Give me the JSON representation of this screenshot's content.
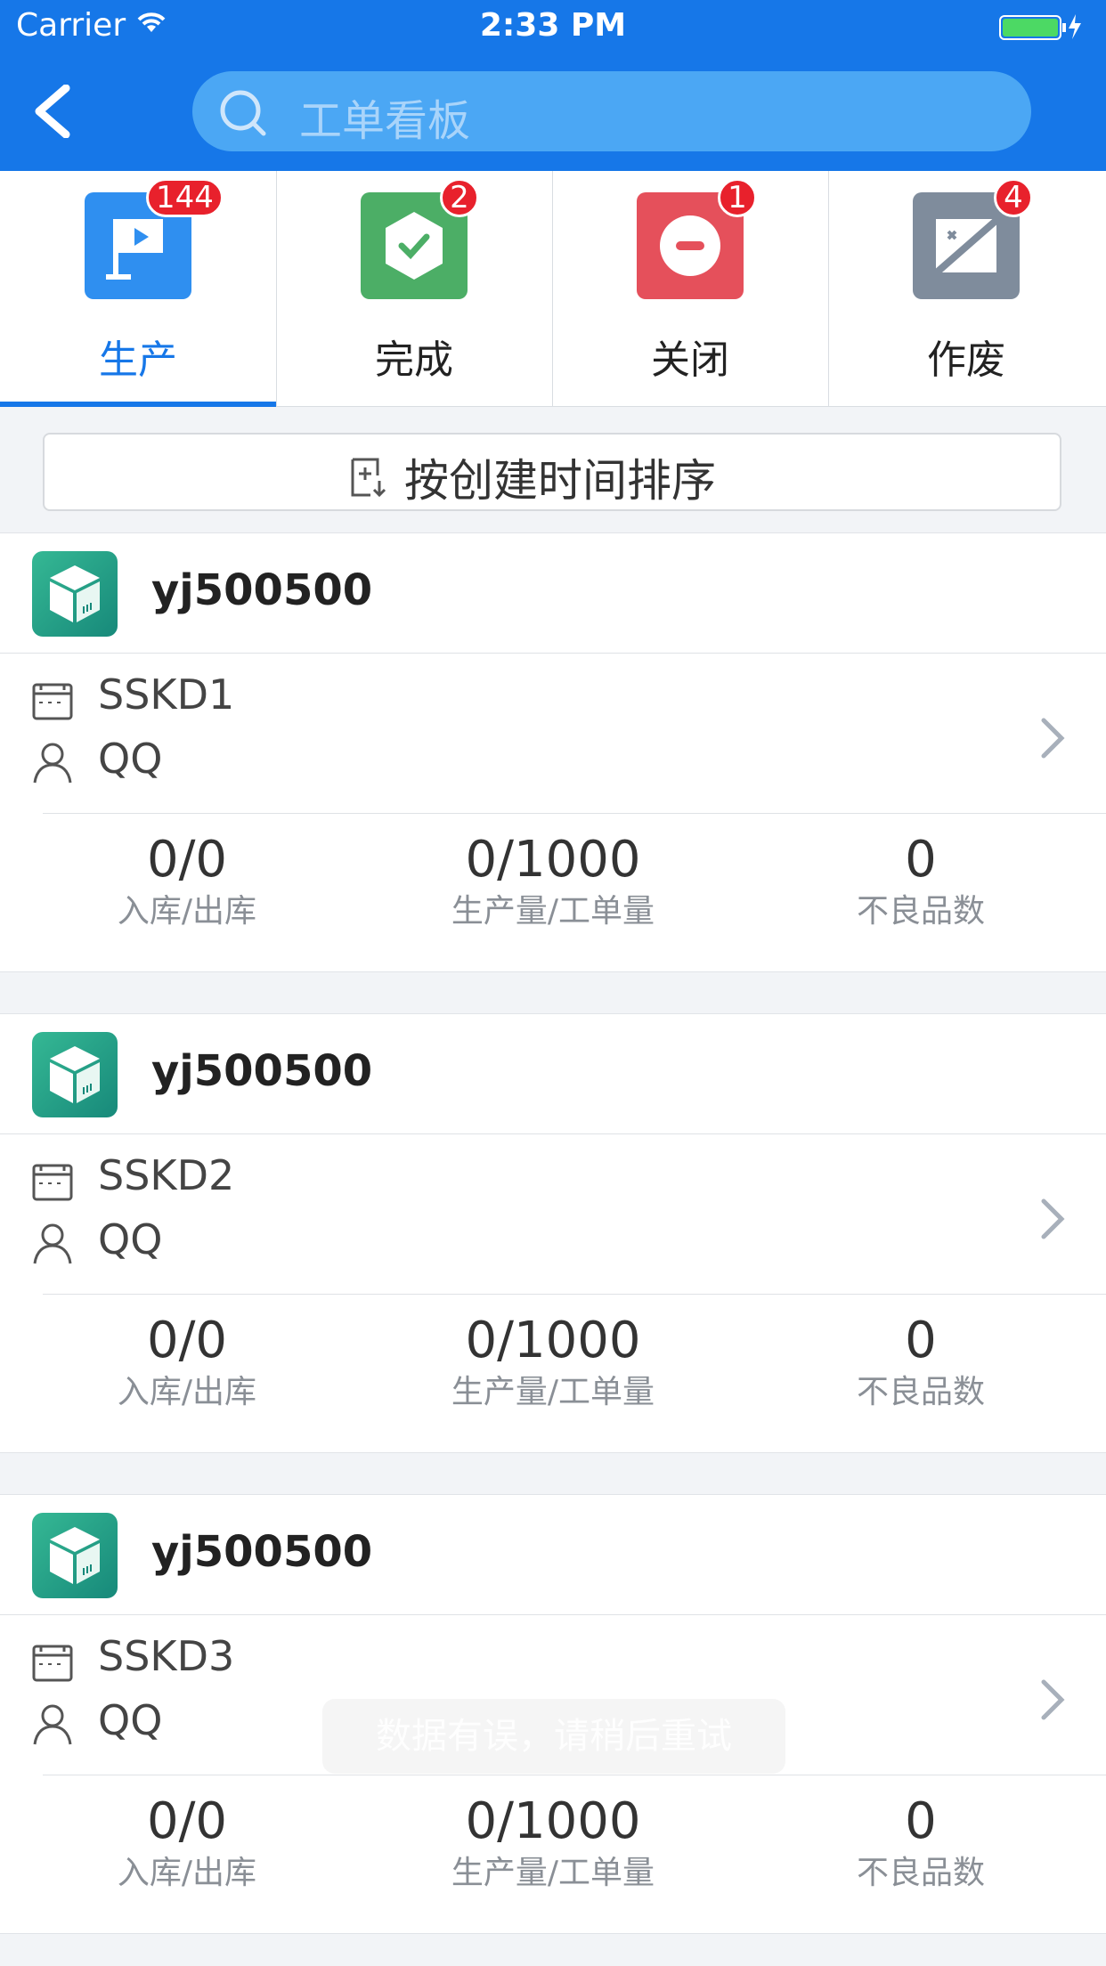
{
  "status_bar": {
    "carrier": "Carrier",
    "time": "2:33 PM"
  },
  "header": {
    "search_placeholder": "工单看板",
    "back_icon": "chevron-left-icon",
    "search_icon": "search-icon"
  },
  "tabs": [
    {
      "label": "生产",
      "badge": "144",
      "icon": "flag-icon",
      "color": "#2f8ff0",
      "active": true
    },
    {
      "label": "完成",
      "badge": "2",
      "icon": "check-shield-icon",
      "color": "#4cae66"
    },
    {
      "label": "关闭",
      "badge": "1",
      "icon": "minus-circle-icon",
      "color": "#e5505b"
    },
    {
      "label": "作废",
      "badge": "4",
      "icon": "void-icon",
      "color": "#7f8c9c"
    }
  ],
  "sort": {
    "label": "按创建时间排序",
    "icon": "sort-doc-icon"
  },
  "orders": [
    {
      "product": "yj500500",
      "order_no": "SSKD1",
      "user": "QQ",
      "stats": [
        {
          "value": "0/0",
          "label": "入库/出库"
        },
        {
          "value": "0/1000",
          "label": "生产量/工单量"
        },
        {
          "value": "0",
          "label": "不良品数"
        }
      ]
    },
    {
      "product": "yj500500",
      "order_no": "SSKD2",
      "user": "QQ",
      "stats": [
        {
          "value": "0/0",
          "label": "入库/出库"
        },
        {
          "value": "0/1000",
          "label": "生产量/工单量"
        },
        {
          "value": "0",
          "label": "不良品数"
        }
      ]
    },
    {
      "product": "yj500500",
      "order_no": "SSKD3",
      "user": "QQ",
      "stats": [
        {
          "value": "0/0",
          "label": "入库/出库"
        },
        {
          "value": "0/1000",
          "label": "生产量/工单量"
        },
        {
          "value": "0",
          "label": "不良品数"
        }
      ]
    }
  ],
  "toast": "数据有误，请稍后重试",
  "colors": {
    "primary": "#1677e8",
    "badge": "#e8212c"
  }
}
